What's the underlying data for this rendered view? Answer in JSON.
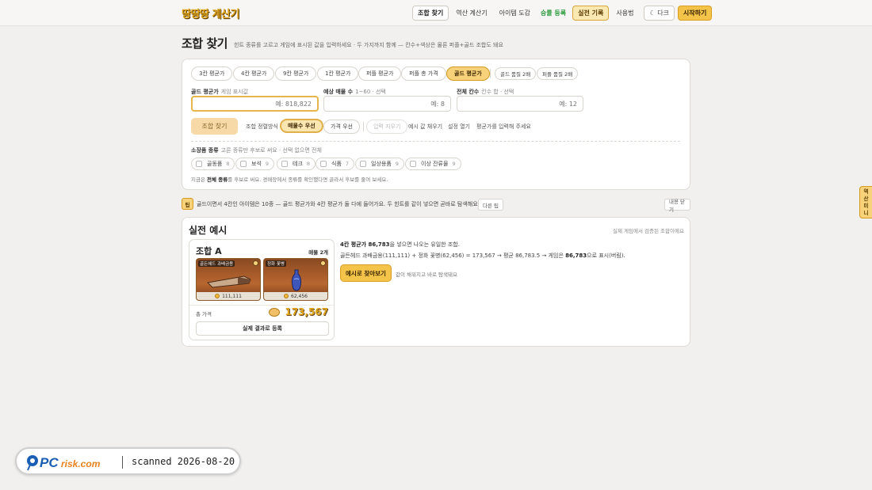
{
  "header": {
    "logo": "땅땅땅 계산기",
    "nav": [
      "조합 찾기",
      "역산 계산기",
      "아이템 도감",
      "승률 등록",
      "실전 기록",
      "사용법"
    ],
    "dark_label": "☾ 다크",
    "start_label": "시작하기"
  },
  "page": {
    "title": "조합 찾기",
    "description": "힌트 종류를 고르고 게임에 표시된 값을 입력하세요 · 두 가지까지 함께 — 칸수+색상은 물론 퍼플+골드 조합도 돼요"
  },
  "hint_types": [
    "3칸 평균가",
    "4칸 평균가",
    "9칸 평균가",
    "1칸 평균가",
    "퍼플 평균가",
    "퍼플 총 가격",
    "골드 평균가"
  ],
  "hint_extra": [
    "골드 품질 2배",
    "퍼플 품질 2배"
  ],
  "fields": {
    "gold_avg": {
      "label": "골드 평균가",
      "hint": "게임 표시값",
      "placeholder": "예: 818,822"
    },
    "count": {
      "label": "예상 매물 수",
      "hint": "1~60 · 선택",
      "placeholder": "예: 8"
    },
    "cells": {
      "label": "전체 칸수",
      "hint": "칸수 합 · 선택",
      "placeholder": "예: 12"
    }
  },
  "actions": {
    "find": "조합 찾기",
    "sort_label": "조합 정렬방식",
    "sort_options": [
      "매물수 우선",
      "가격 우선"
    ],
    "clear": "입력 지우기",
    "fill_example": "예시 값 채우기",
    "open_settings": "설정 열기",
    "status": "평균가를 입력해 주세요"
  },
  "categories": {
    "title": "소장품 종류",
    "hint": "고른 종류만 후보로 써요 · 선택 없으면 전체",
    "items": [
      {
        "name": "골동품",
        "count": "8"
      },
      {
        "name": "보석",
        "count": "9"
      },
      {
        "name": "테크",
        "count": "8"
      },
      {
        "name": "식품",
        "count": "7"
      },
      {
        "name": "일상용품",
        "count": "9"
      },
      {
        "name": "이상 잔류물",
        "count": "9"
      }
    ],
    "note_pre": "지금은 ",
    "note_bold": "전체 종류",
    "note_post": "를 후보로 써요. 경매장에서 종류를 확인했다면 골라서 후보를 줄여 보세요."
  },
  "tip": {
    "icon": "팁",
    "text": "골드이면서 4칸인 아이템은 10종 — 골드 평균가와 4칸 평균가 둘 다에 들어가요. 두 힌트를 같이 넣으면 곧바로 탐색해요.",
    "next": "다른 팁",
    "close": "내용 닫기"
  },
  "example": {
    "title": "실전 예시",
    "subtitle": "실제 게임에서 검증된 조합이에요",
    "combo_name": "조합 A",
    "combo_count": "매물 2개",
    "items": [
      {
        "name": "골든헤드 과배금용",
        "price": "111,111"
      },
      {
        "name": "정화 꽃병",
        "price": "62,456"
      }
    ],
    "total_label": "총 가격",
    "total_value": "173,567",
    "register": "실제 결과로 등록",
    "desc1_bold": "4칸 평균가 86,783",
    "desc1_rest": "을 넣으면 나오는 유일한 조합.",
    "desc2_pre": "골든헤드 과배금용(111,111) + 정화 꽃병(62,456) = 173,567 → 평균 86,783.5 → 게임은 ",
    "desc2_bold": "86,783",
    "desc2_post": "으로 표시(버림).",
    "try_button": "예시로 찾아보기",
    "try_note": "값이 채워지고 바로 탐색돼요"
  },
  "sidetab": [
    "역",
    "산",
    "미",
    "니"
  ],
  "watermark": {
    "brand": "PCrisk.com",
    "text": "scanned 2026-08-20"
  },
  "colors": {
    "accent": "#f3c34a",
    "gold_text": "#e0a51b",
    "green": "#2c9b3f"
  }
}
